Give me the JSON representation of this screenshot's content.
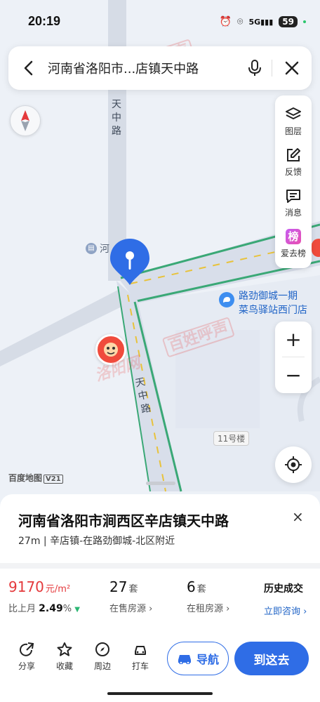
{
  "status_bar": {
    "time": "20:19",
    "signal_text": "5G",
    "battery": "59",
    "icons": [
      "alarm-icon",
      "location-icon",
      "signal-icon",
      "battery-icon"
    ]
  },
  "search": {
    "query": "河南省洛阳市...店镇天中路",
    "icons": [
      "back-arrow-icon",
      "microphone-icon",
      "close-icon"
    ]
  },
  "tools": [
    {
      "label": "图层",
      "icon": "layers-icon"
    },
    {
      "label": "反馈",
      "icon": "edit-icon"
    },
    {
      "label": "消息",
      "icon": "message-icon"
    },
    {
      "label": "爱去榜",
      "icon": "ranking-icon",
      "badge": "榜"
    }
  ],
  "zoom": {
    "in": "+",
    "out": "−"
  },
  "map": {
    "road_labels": [
      "天",
      "中",
      "路"
    ],
    "poi_partial": "河",
    "poi_name_line1": "路劲御城一期",
    "poi_name_line2": "菜鸟驿站西门店",
    "building": "11号楼",
    "logo": "百度地图",
    "logo_version": "V21",
    "watermark": "百姓呼声",
    "watermark_prefix": "洛阳网"
  },
  "card": {
    "title": "河南省洛阳市涧西区辛店镇天中路",
    "subtitle": "27m | 辛店镇-在路劲御城-北区附近",
    "close": "×"
  },
  "stats": {
    "price_value": "9170",
    "price_unit": "元/m²",
    "price_change_label": "比上月",
    "price_change_pct": "2.49",
    "price_change_suffix": "%",
    "sale_count": "27",
    "sale_unit": "套",
    "sale_label": "在售房源 ›",
    "rent_count": "6",
    "rent_unit": "套",
    "rent_label": "在租房源 ›",
    "history_title": "历史成交",
    "history_link": "立即咨询 ›"
  },
  "actions": [
    {
      "label": "分享",
      "icon": "share-icon"
    },
    {
      "label": "收藏",
      "icon": "star-icon"
    },
    {
      "label": "周边",
      "icon": "compass-icon"
    },
    {
      "label": "打车",
      "icon": "taxi-icon"
    }
  ],
  "nav_label": "导航",
  "go_label": "到这去",
  "colors": {
    "accent": "#2f6de6",
    "price": "#e4393c",
    "road_green": "#3aa876",
    "map_bg": "#edf1f7"
  }
}
